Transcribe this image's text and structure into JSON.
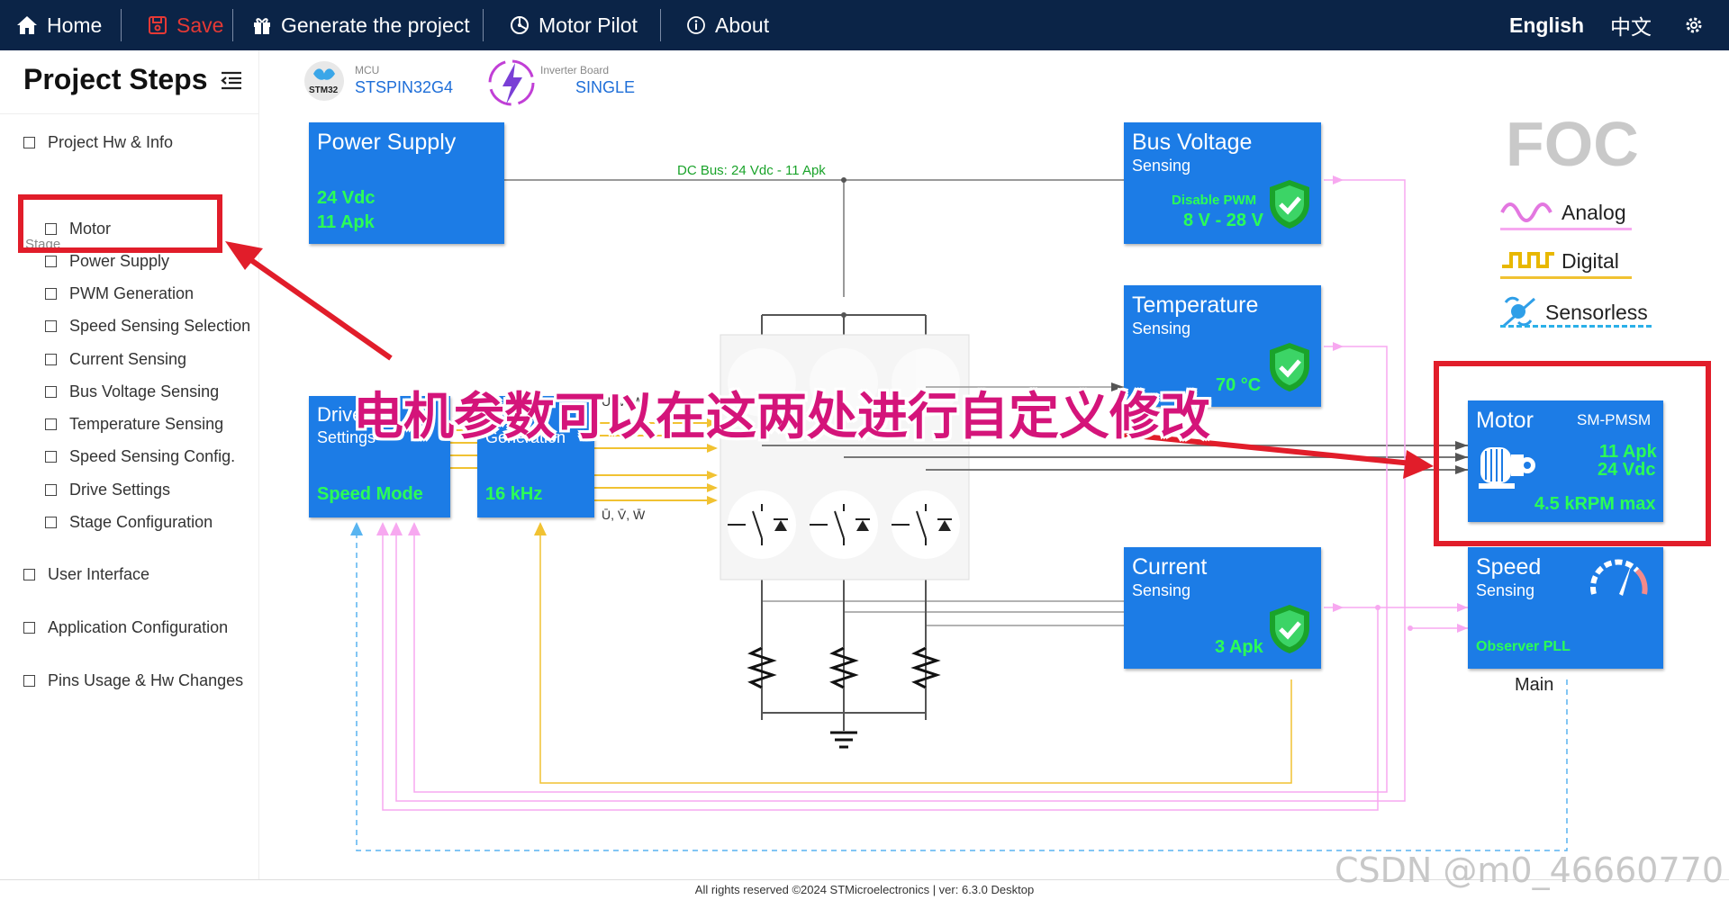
{
  "nav": {
    "home": "Home",
    "save": "Save",
    "generate": "Generate the project",
    "pilot": "Motor Pilot",
    "about": "About",
    "lang_en": "English",
    "lang_cn": "中文"
  },
  "sidebar": {
    "title": "Project Steps",
    "hw_info": "Project Hw & Info",
    "stage_label": "Stage",
    "items": [
      "Motor",
      "Power Supply",
      "PWM Generation",
      "Speed Sensing Selection",
      "Current Sensing",
      "Bus Voltage Sensing",
      "Temperature Sensing",
      "Speed Sensing Config.",
      "Drive Settings",
      "Stage Configuration"
    ],
    "user_interface": "User Interface",
    "app_config": "Application Configuration",
    "pins": "Pins Usage & Hw Changes"
  },
  "header": {
    "mcu_label": "MCU",
    "mcu_value": "STSPIN32G4",
    "mcu_logo_text": "STM32",
    "board_label": "Inverter Board",
    "board_value": "SINGLE"
  },
  "diagram": {
    "dc_bus": "DC Bus: 24 Vdc - 11 Apk",
    "uvw_top": "U, V, W",
    "uvw_bottom": "Ū, V̄, W̄",
    "power_supply": {
      "title": "Power Supply",
      "v": "24 Vdc",
      "a": "11 Apk"
    },
    "bus_voltage": {
      "title": "Bus Voltage",
      "sub": "Sensing",
      "extra": "Disable PWM",
      "range": "8 V - 28 V"
    },
    "temperature": {
      "title": "Temperature",
      "sub": "Sensing",
      "value": "70 °C"
    },
    "drive": {
      "title": "Drive",
      "sub": "Settings",
      "mode": "Speed Mode"
    },
    "pwm": {
      "title": "PWM",
      "sub": "Generation",
      "freq": "16 kHz"
    },
    "current": {
      "title": "Current",
      "sub": "Sensing",
      "value": "3 Apk"
    },
    "motor": {
      "title": "Motor",
      "type": "SM-PMSM",
      "a": "11 Apk",
      "v": "24 Vdc",
      "rpm": "4.5 kRPM max"
    },
    "speed": {
      "title": "Speed",
      "sub": "Sensing",
      "algo": "Observer PLL",
      "main": "Main"
    }
  },
  "legend": {
    "foc": "FOC",
    "analog": "Analog",
    "digital": "Digital",
    "sensorless": "Sensorless"
  },
  "annotation": "电机参数可以在这两处进行自定义修改",
  "footer": "All rights reserved ©2024 STMicroelectronics | ver: 6.3.0 Desktop",
  "watermark": "CSDN @m0_46660770",
  "colors": {
    "topbar": "#0b2447",
    "block": "#1c7ce6",
    "green": "#2bff56",
    "highlight": "#e11d2a",
    "save": "#e53935"
  }
}
